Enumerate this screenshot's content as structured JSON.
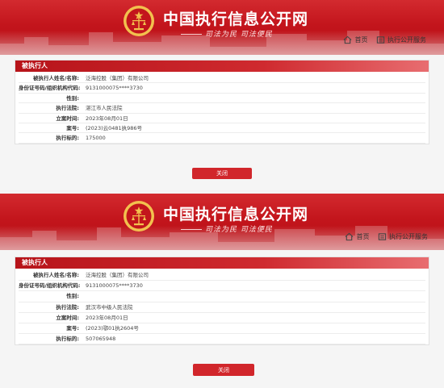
{
  "screens": [
    {
      "site_title": "中国执行信息公开网",
      "slogan": "司法为民  司法便民",
      "nav": [
        {
          "label": "首页",
          "icon": "home-icon"
        },
        {
          "label": "执行公开服务",
          "icon": "service-icon"
        }
      ],
      "section_title": "被执行人",
      "rows": [
        {
          "label": "被执行人姓名/名称:",
          "value": "泛海控股（集团）有限公司"
        },
        {
          "label": "身份证号码/组织机构代码:",
          "value": "9131000075****3730"
        },
        {
          "label": "性别:",
          "value": ""
        },
        {
          "label": "执行法院:",
          "value": "湛江市人民法院"
        },
        {
          "label": "立案时间:",
          "value": "2023年08月01日"
        },
        {
          "label": "案号:",
          "value": "(2023)云0481执986号"
        },
        {
          "label": "执行标的:",
          "value": "175000"
        }
      ],
      "close_label": "关闭"
    },
    {
      "site_title": "中国执行信息公开网",
      "slogan": "司法为民  司法便民",
      "nav": [
        {
          "label": "首页",
          "icon": "home-icon"
        },
        {
          "label": "执行公开服务",
          "icon": "service-icon"
        }
      ],
      "section_title": "被执行人",
      "rows": [
        {
          "label": "被执行人姓名/名称:",
          "value": "泛海控股（集团）有限公司"
        },
        {
          "label": "身份证号码/组织机构代码:",
          "value": "9131000075****3730"
        },
        {
          "label": "性别:",
          "value": ""
        },
        {
          "label": "执行法院:",
          "value": "武汉市中级人民法院"
        },
        {
          "label": "立案时间:",
          "value": "2023年08月01日"
        },
        {
          "label": "案号:",
          "value": "(2023)鄂01执2604号"
        },
        {
          "label": "执行标的:",
          "value": "507065948"
        }
      ],
      "close_label": "关闭"
    }
  ],
  "colors": {
    "header_red": "#c3151c",
    "bar_red": "#b7141a",
    "button_red": "#d1262b",
    "emblem_gold": "#f2c14e"
  }
}
